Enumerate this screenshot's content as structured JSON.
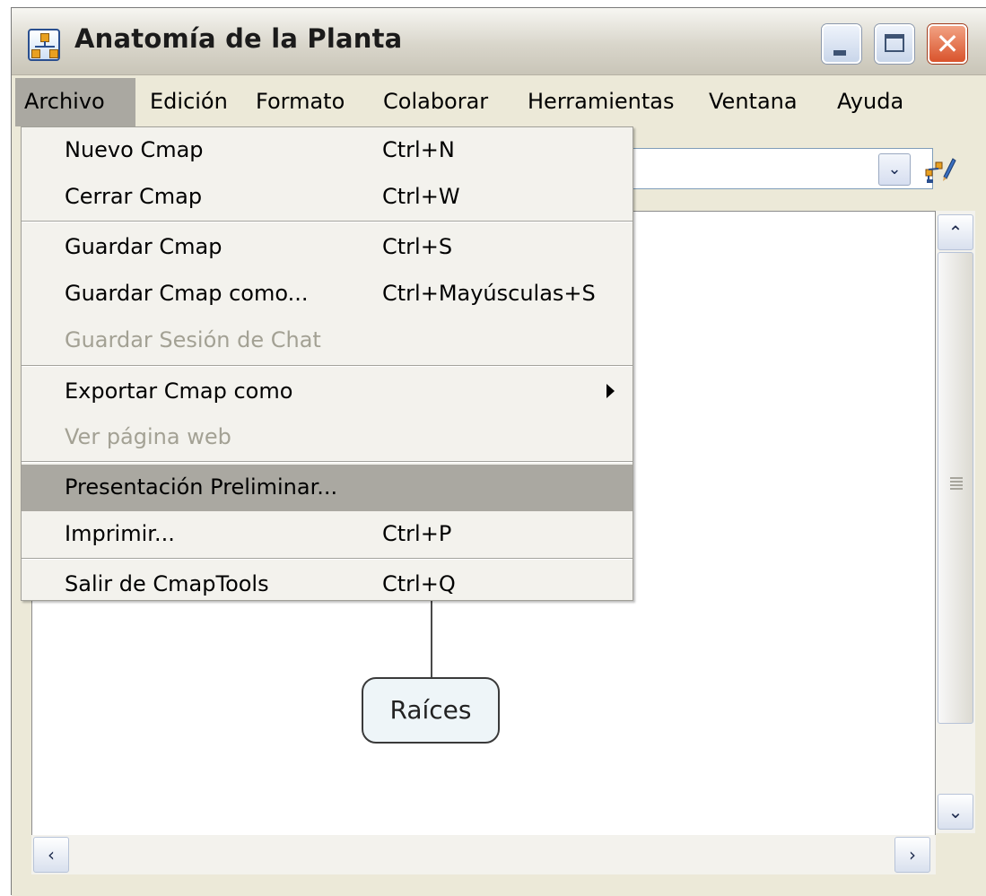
{
  "window": {
    "title": "Anatomía de la Planta"
  },
  "menubar": {
    "items": [
      {
        "label": "Archivo",
        "active": true
      },
      {
        "label": "Edición"
      },
      {
        "label": "Formato"
      },
      {
        "label": "Colaborar"
      },
      {
        "label": "Herramientas"
      },
      {
        "label": "Ventana"
      },
      {
        "label": "Ayuda"
      }
    ]
  },
  "file_menu": {
    "items": [
      {
        "label": "Nuevo Cmap",
        "shortcut": "Ctrl+N"
      },
      {
        "label": "Cerrar Cmap",
        "shortcut": "Ctrl+W"
      },
      {
        "label": "Guardar Cmap",
        "shortcut": "Ctrl+S"
      },
      {
        "label": "Guardar Cmap como...",
        "shortcut": "Ctrl+Mayúsculas+S"
      },
      {
        "label": "Guardar Sesión de Chat",
        "shortcut": "",
        "disabled": true
      },
      {
        "label": "Exportar Cmap como",
        "shortcut": "",
        "submenu": true
      },
      {
        "label": "Ver página web",
        "shortcut": "",
        "disabled": true
      },
      {
        "label": "Presentación Preliminar...",
        "shortcut": "",
        "highlighted": true
      },
      {
        "label": "Imprimir...",
        "shortcut": "Ctrl+P"
      },
      {
        "label": "Salir de CmapTools",
        "shortcut": "Ctrl+Q"
      }
    ]
  },
  "canvas": {
    "node_label": "Raíces"
  },
  "icons": {
    "app": "concept-map-icon",
    "edit": "edit-pencil-icon",
    "combo": "chevron-down-icon"
  },
  "colors": {
    "menu_highlight": "#aaa8a1",
    "chrome": "#ece9d8",
    "node_fill": "#eef5f8"
  }
}
